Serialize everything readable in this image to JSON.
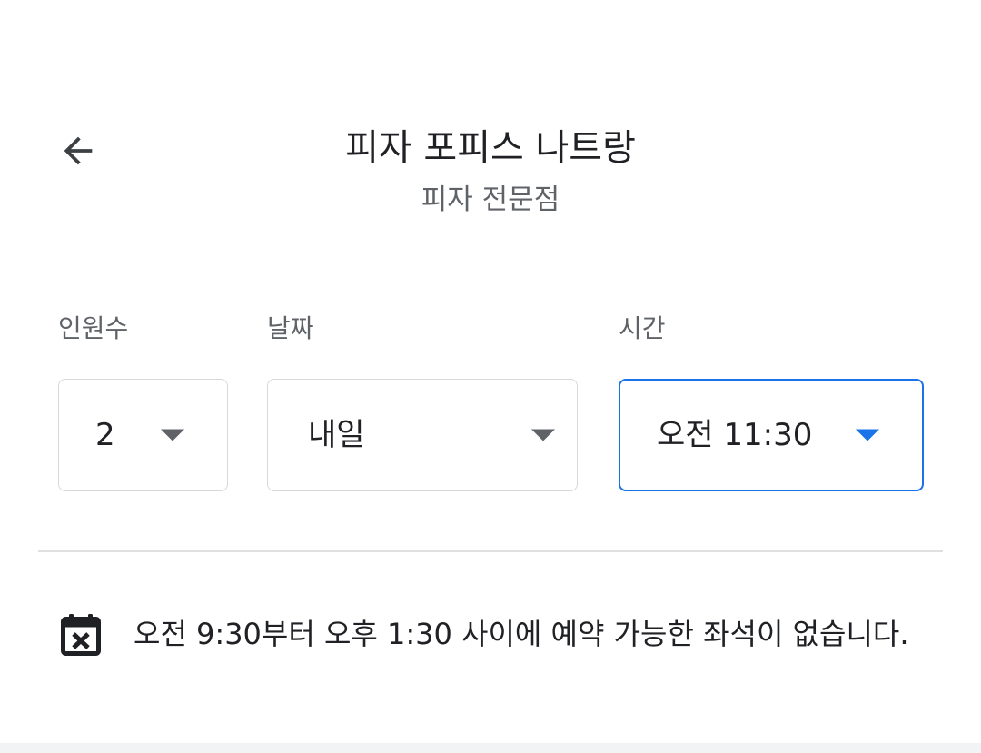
{
  "header": {
    "back_icon": "arrow-back-icon",
    "title": "피자 포피스 나트랑",
    "subtitle": "피자 전문점"
  },
  "booking": {
    "party": {
      "label": "인원수",
      "value": "2"
    },
    "date": {
      "label": "날짜",
      "value": "내일"
    },
    "time": {
      "label": "시간",
      "value": "오전 11:30"
    }
  },
  "notice": {
    "icon": "calendar-unavailable-icon",
    "text": "오전 9:30부터 오후 1:30 사이에 예약 가능한 좌석이 없습니다."
  },
  "colors": {
    "accent": "#1a73e8",
    "text_primary": "#202124",
    "text_secondary": "#5f6368",
    "border": "#d6d9dc",
    "divider": "#e0e0e0"
  }
}
